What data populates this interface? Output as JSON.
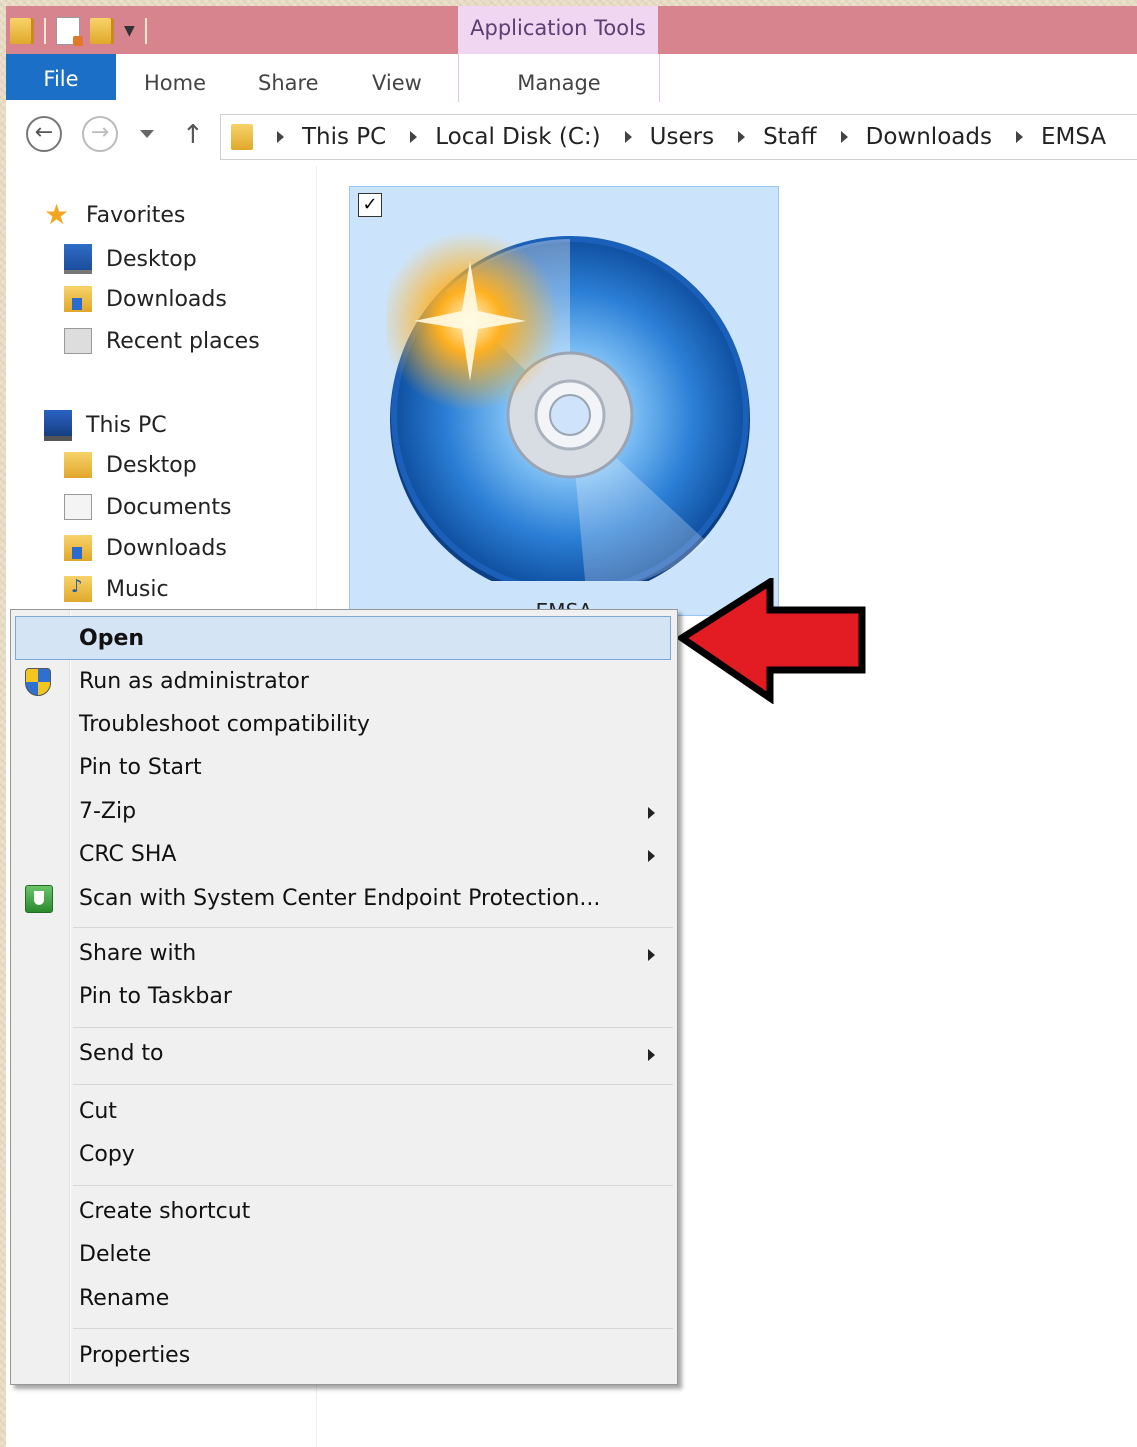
{
  "ribbon": {
    "context_group": "Application Tools",
    "tabs": {
      "file": "File",
      "home": "Home",
      "share": "Share",
      "view": "View",
      "manage": "Manage"
    }
  },
  "address": {
    "crumbs": [
      "This PC",
      "Local Disk (C:)",
      "Users",
      "Staff",
      "Downloads",
      "EMSA"
    ]
  },
  "navpane": {
    "favorites": "Favorites",
    "fav_items": [
      "Desktop",
      "Downloads",
      "Recent places"
    ],
    "this_pc": "This PC",
    "pc_items": [
      "Desktop",
      "Documents",
      "Downloads",
      "Music"
    ]
  },
  "file": {
    "name": "EMSA",
    "checked": true
  },
  "context_menu": {
    "items": [
      "Open",
      "Run as administrator",
      "Troubleshoot compatibility",
      "Pin to Start",
      "7-Zip",
      "CRC SHA",
      "Scan with System Center Endpoint Protection...",
      "Share with",
      "Pin to Taskbar",
      "Send to",
      "Cut",
      "Copy",
      "Create shortcut",
      "Delete",
      "Rename",
      "Properties"
    ]
  },
  "icons": {
    "back": "back-arrow-icon",
    "forward": "forward-arrow-icon",
    "up": "up-arrow-icon",
    "favorites": "star-icon",
    "disc": "disc-installer-icon",
    "uac": "uac-shield-icon",
    "scep": "endpoint-protection-icon",
    "annotation": "red-arrow-icon"
  },
  "colors": {
    "title_bar": "#d7848e",
    "context_tab": "#f1d6f2",
    "file_tab": "#1b6fc6",
    "selection": "#cce4fb",
    "annotation_arrow": "#e31b23"
  }
}
